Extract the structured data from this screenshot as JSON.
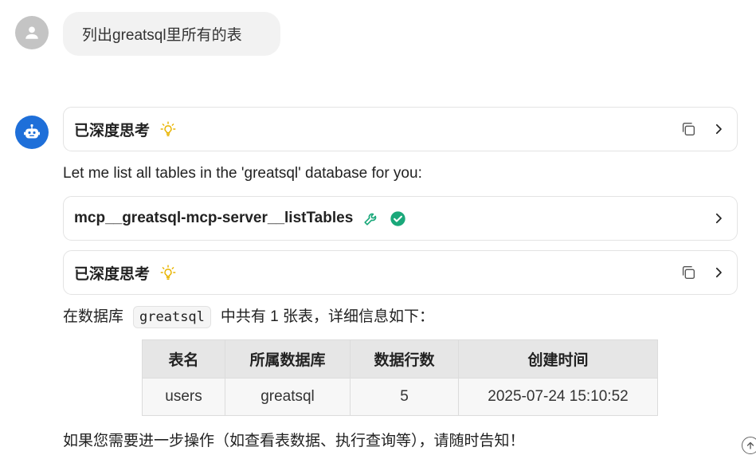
{
  "user_message": {
    "text": "列出greatsql里所有的表",
    "avatar_icon": "person-icon"
  },
  "assistant": {
    "avatar_icon": "robot-icon",
    "thinking_1": {
      "label": "已深度思考",
      "icon": "lightbulb-icon"
    },
    "intro_text": "Let me list all tables in the 'greatsql' database for you:",
    "tool_call": {
      "name": "mcp__greatsql-mcp-server__listTables",
      "tool_icon": "wrench-icon",
      "status_icon": "check-circle-icon",
      "status_color": "#1aa87a"
    },
    "thinking_2": {
      "label": "已深度思考",
      "icon": "lightbulb-icon"
    },
    "summary": {
      "prefix": "在数据库",
      "db_name": "greatsql",
      "suffix": "中共有 1 张表，详细信息如下："
    },
    "table": {
      "headers": [
        "表名",
        "所属数据库",
        "数据行数",
        "创建时间"
      ],
      "rows": [
        [
          "users",
          "greatsql",
          "5",
          "2025-07-24 15:10:52"
        ]
      ]
    },
    "closing_text": "如果您需要进一步操作（如查看表数据、执行查询等），请随时告知！"
  },
  "colors": {
    "bot_avatar": "#1e6fd9",
    "user_avatar": "#c4c4c4",
    "lightbulb": "#e8b400"
  }
}
